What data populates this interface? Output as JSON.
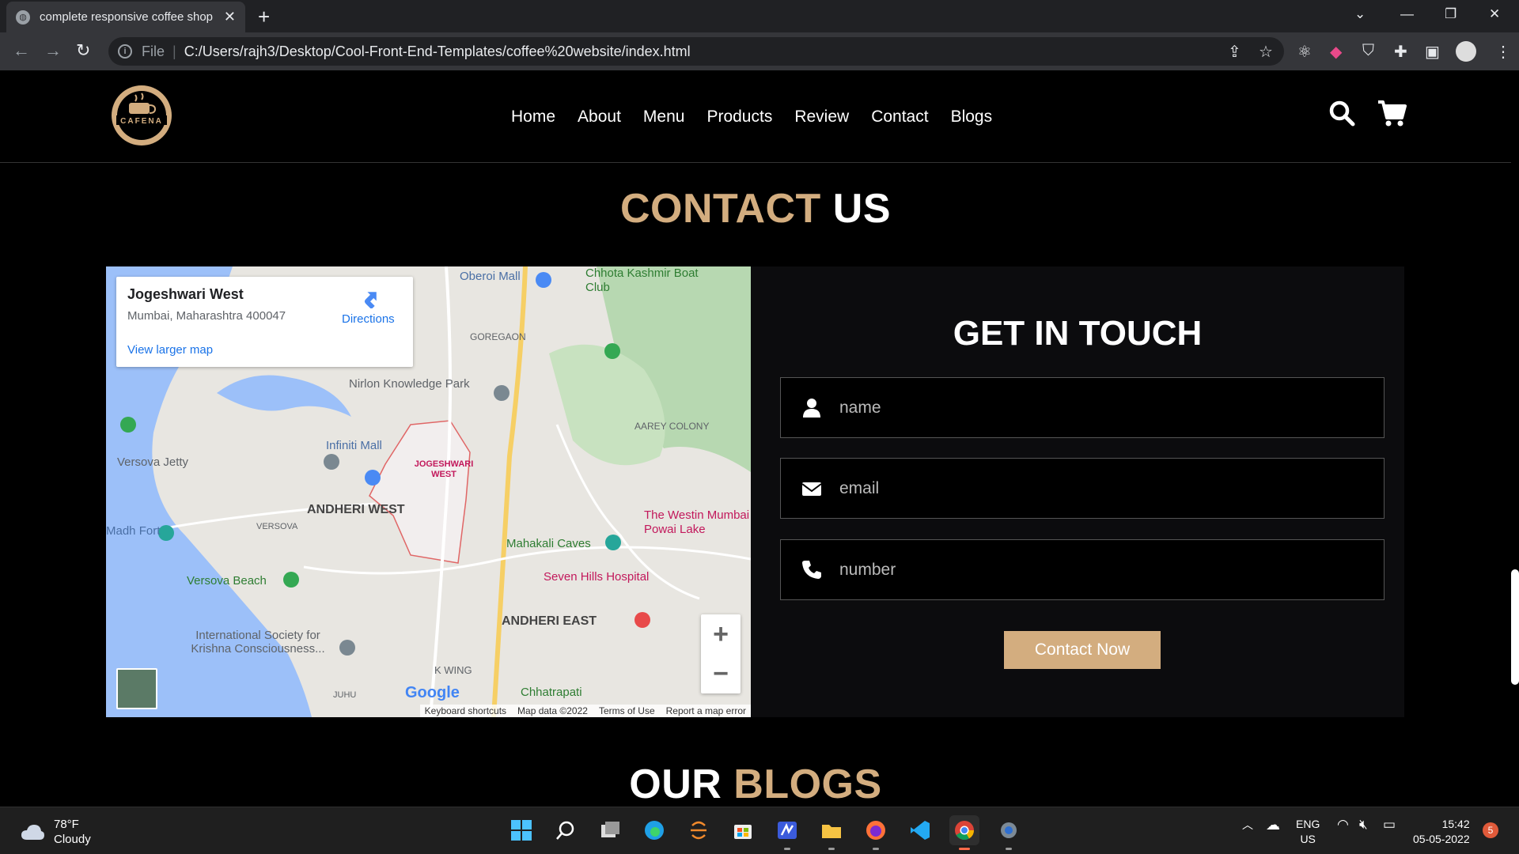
{
  "browser": {
    "tab_title": "complete responsive coffee shop",
    "tab_close": "✕",
    "new_tab": "+",
    "url_scheme": "File",
    "url": "C:/Users/rajh3/Desktop/Cool-Front-End-Templates/coffee%20website/index.html"
  },
  "site": {
    "logo_text": "CAFENA",
    "nav": [
      "Home",
      "About",
      "Menu",
      "Products",
      "Review",
      "Contact",
      "Blogs"
    ],
    "accent_color": "#d3ad7f"
  },
  "contact": {
    "heading_accent": "CONTACT",
    "heading_rest": "US",
    "form_title": "GET IN TOUCH",
    "fields": [
      {
        "icon": "user-icon",
        "placeholder": "name"
      },
      {
        "icon": "envelope-icon",
        "placeholder": "email"
      },
      {
        "icon": "phone-icon",
        "placeholder": "number"
      }
    ],
    "submit_label": "Contact Now"
  },
  "map": {
    "place_title": "Jogeshwari West",
    "place_address": "Mumbai, Maharashtra 400047",
    "directions_label": "Directions",
    "larger_map_label": "View larger map",
    "zoom_in": "+",
    "zoom_out": "−",
    "google": "Google",
    "footer": [
      "Keyboard shortcuts",
      "Map data ©2022",
      "Terms of Use",
      "Report a map error"
    ],
    "labels": {
      "oberoi": "Oberoi Mall",
      "chhota": "Chhota Kashmir Boat Club",
      "goregaon": "GOREGAON",
      "nirlon": "Nirlon Knowledge Park",
      "aarey": "AAREY COLONY",
      "infiniti": "Infiniti Mall",
      "jogeshwari": "JOGESHWARI WEST",
      "versova_jetty": "Versova Jetty",
      "andheri_west": "ANDHERI WEST",
      "versova": "VERSOVA",
      "fort": "Madh Fort",
      "westin": "The Westin Mumbai Powai Lake",
      "mahakali": "Mahakali Caves",
      "seven_hills": "Seven Hills Hospital",
      "versova_beach": "Versova Beach",
      "andheri_east": "ANDHERI EAST",
      "iskcon": "International Society for Krishna Consciousness...",
      "kwing": "K WING",
      "juhu": "JUHU",
      "chhatrapati": "Chhatrapati"
    }
  },
  "blogs": {
    "heading_rest": "OUR",
    "heading_accent": "BLOGS"
  },
  "taskbar": {
    "temp": "78°F",
    "condition": "Cloudy",
    "lang_top": "ENG",
    "lang_bottom": "US",
    "time": "15:42",
    "date": "05-05-2022",
    "notifications": "5"
  }
}
